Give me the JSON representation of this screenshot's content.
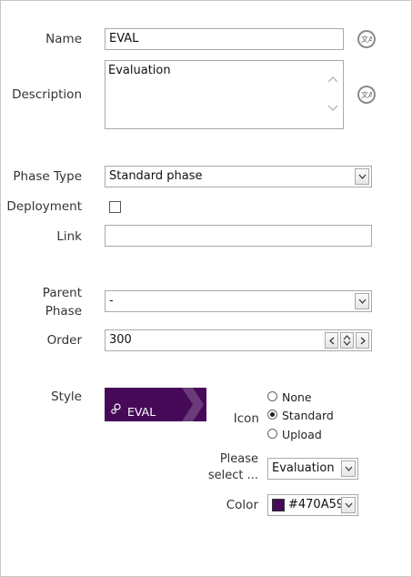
{
  "fields": {
    "name": {
      "label": "Name",
      "value": "EVAL"
    },
    "description": {
      "label": "Description",
      "value": "Evaluation"
    },
    "phase_type": {
      "label": "Phase Type",
      "value": "Standard phase"
    },
    "deployment": {
      "label": "Deployment",
      "checked": false
    },
    "link": {
      "label": "Link",
      "value": ""
    },
    "parent_phase": {
      "label_line1": "Parent",
      "label_line2": "Phase",
      "value": "-"
    },
    "order": {
      "label": "Order",
      "value": "300"
    },
    "style": {
      "label": "Style",
      "preview_text": "EVAL"
    }
  },
  "icon": {
    "label": "Icon",
    "options": [
      "None",
      "Standard",
      "Upload"
    ],
    "selected": "Standard",
    "select_label_line1": "Please",
    "select_label_line2": "select ...",
    "select_value": "Evaluation"
  },
  "color": {
    "label": "Color",
    "value": "#470A59"
  },
  "colors": {
    "accent": "#470A59",
    "chevron": "#6b3a7a"
  },
  "icons": {
    "translate": "translate-icon",
    "gears": "gears-icon",
    "dropdown": "chevron-down-icon"
  }
}
